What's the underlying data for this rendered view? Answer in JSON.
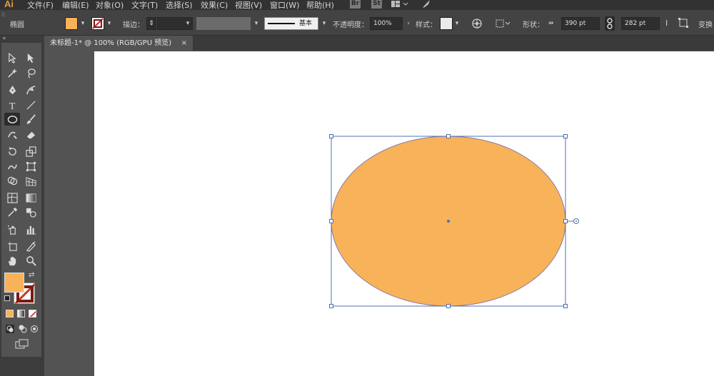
{
  "app": {
    "logo": "Ai"
  },
  "menu": {
    "items": [
      {
        "label": "文件(F)"
      },
      {
        "label": "编辑(E)"
      },
      {
        "label": "对象(O)"
      },
      {
        "label": "文字(T)"
      },
      {
        "label": "选择(S)"
      },
      {
        "label": "效果(C)"
      },
      {
        "label": "视图(V)"
      },
      {
        "label": "窗口(W)"
      },
      {
        "label": "帮助(H)"
      }
    ],
    "bridge": "Br",
    "stock": "St"
  },
  "control": {
    "selection_label": "椭圆",
    "fill_color": "#f8b25a",
    "stroke_label": "描边：",
    "brush_label": "基本",
    "opacity_label": "不透明度：",
    "opacity_value": "100%",
    "style_label": "样式：",
    "shape_label": "形状：",
    "width_value": "390 pt",
    "height_value": "282 pt",
    "transform_label": "变换"
  },
  "document": {
    "tab_title": "未标题-1* @ 100% (RGB/GPU 预览)",
    "close_glyph": "×"
  },
  "colors": {
    "fill": "#f8b25a",
    "stroke": "#c8392b",
    "selection": "#4f6fb3",
    "artboard": "#ffffff"
  },
  "tools": [
    "selection-icon",
    "direct-selection-icon",
    "magic-wand-icon",
    "lasso-icon",
    "pen-icon",
    "curvature-icon",
    "type-icon",
    "line-segment-icon",
    "ellipse-icon",
    "paintbrush-icon",
    "shaper-icon",
    "eraser-icon",
    "rotate-icon",
    "scale-icon",
    "warp-icon",
    "free-transform-icon",
    "shape-builder-icon",
    "perspective-grid-icon",
    "mesh-icon",
    "gradient-icon",
    "eyedropper-icon",
    "blend-icon",
    "symbol-sprayer-icon",
    "column-graph-icon",
    "artboard-icon",
    "slice-icon",
    "hand-icon",
    "zoom-icon"
  ]
}
